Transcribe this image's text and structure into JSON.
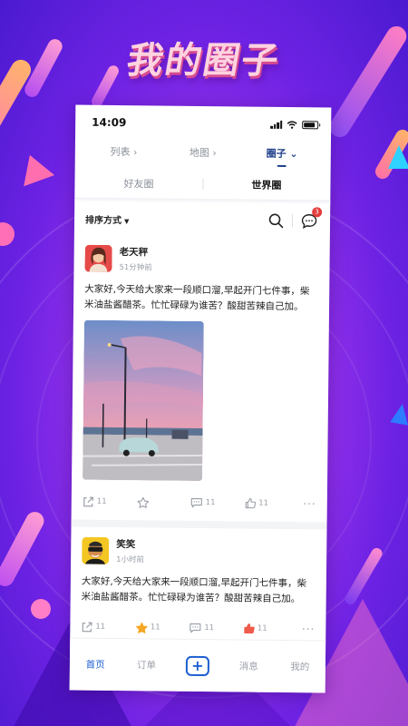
{
  "banner": {
    "title": "我的圈子"
  },
  "status_bar": {
    "time": "14:09"
  },
  "nav_tabs": [
    {
      "label": "列表 ›",
      "active": false
    },
    {
      "label": "地图 ›",
      "active": false
    },
    {
      "label": "圈子 ⌄",
      "active": true
    }
  ],
  "sub_tabs": [
    {
      "label": "好友圈",
      "active": false
    },
    {
      "label": "世界圈",
      "active": true
    }
  ],
  "toolbar": {
    "sort_label": "排序方式",
    "message_badge": "3"
  },
  "posts": [
    {
      "author": "老天秤",
      "time": "51分钟前",
      "text": "大家好,今天给大家来一段顺口溜,早起开门七件事，柴米油盐酱醋茶。忙忙碌碌为谁苦？酸甜苦辣自己加。",
      "share_count": "11",
      "fav_count": "",
      "comment_count": "11",
      "like_count": "11"
    },
    {
      "author": "笑笑",
      "time": "1小时前",
      "text": "大家好,今天给大家来一段顺口溜,早起开门七件事，柴米油盐酱醋茶。忙忙碌碌为谁苦？酸甜苦辣自己加。",
      "share_count": "11",
      "fav_count": "11",
      "comment_count": "11",
      "like_count": "11"
    }
  ],
  "bottom_nav": {
    "home": "首页",
    "orders": "订单",
    "messages": "消息",
    "mine": "我的"
  },
  "colors": {
    "accent": "#1d5fd0",
    "background": "#9a34ec",
    "badge": "#e23c3c"
  }
}
